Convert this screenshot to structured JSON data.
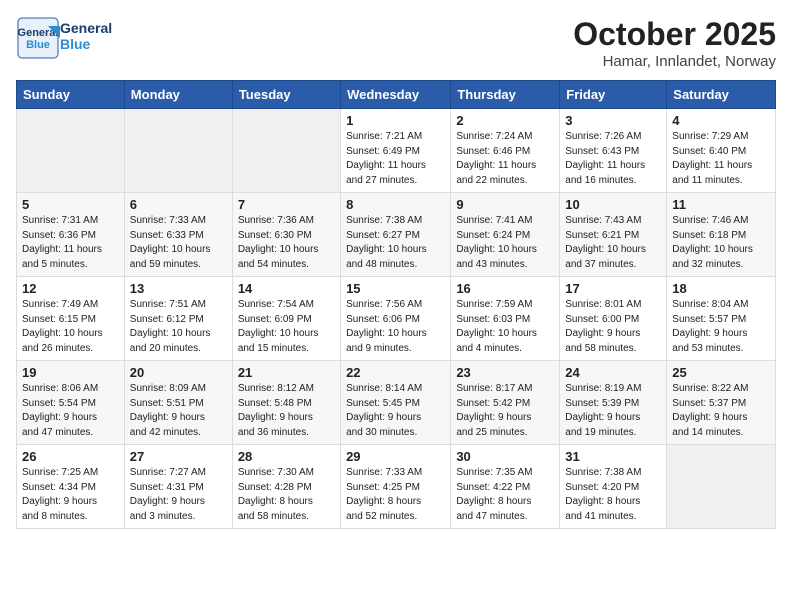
{
  "header": {
    "logo_text_top": "General",
    "logo_text_bottom": "Blue",
    "month_title": "October 2025",
    "location": "Hamar, Innlandet, Norway"
  },
  "days_of_week": [
    "Sunday",
    "Monday",
    "Tuesday",
    "Wednesday",
    "Thursday",
    "Friday",
    "Saturday"
  ],
  "weeks": [
    [
      {
        "day": "",
        "info": ""
      },
      {
        "day": "",
        "info": ""
      },
      {
        "day": "",
        "info": ""
      },
      {
        "day": "1",
        "info": "Sunrise: 7:21 AM\nSunset: 6:49 PM\nDaylight: 11 hours\nand 27 minutes."
      },
      {
        "day": "2",
        "info": "Sunrise: 7:24 AM\nSunset: 6:46 PM\nDaylight: 11 hours\nand 22 minutes."
      },
      {
        "day": "3",
        "info": "Sunrise: 7:26 AM\nSunset: 6:43 PM\nDaylight: 11 hours\nand 16 minutes."
      },
      {
        "day": "4",
        "info": "Sunrise: 7:29 AM\nSunset: 6:40 PM\nDaylight: 11 hours\nand 11 minutes."
      }
    ],
    [
      {
        "day": "5",
        "info": "Sunrise: 7:31 AM\nSunset: 6:36 PM\nDaylight: 11 hours\nand 5 minutes."
      },
      {
        "day": "6",
        "info": "Sunrise: 7:33 AM\nSunset: 6:33 PM\nDaylight: 10 hours\nand 59 minutes."
      },
      {
        "day": "7",
        "info": "Sunrise: 7:36 AM\nSunset: 6:30 PM\nDaylight: 10 hours\nand 54 minutes."
      },
      {
        "day": "8",
        "info": "Sunrise: 7:38 AM\nSunset: 6:27 PM\nDaylight: 10 hours\nand 48 minutes."
      },
      {
        "day": "9",
        "info": "Sunrise: 7:41 AM\nSunset: 6:24 PM\nDaylight: 10 hours\nand 43 minutes."
      },
      {
        "day": "10",
        "info": "Sunrise: 7:43 AM\nSunset: 6:21 PM\nDaylight: 10 hours\nand 37 minutes."
      },
      {
        "day": "11",
        "info": "Sunrise: 7:46 AM\nSunset: 6:18 PM\nDaylight: 10 hours\nand 32 minutes."
      }
    ],
    [
      {
        "day": "12",
        "info": "Sunrise: 7:49 AM\nSunset: 6:15 PM\nDaylight: 10 hours\nand 26 minutes."
      },
      {
        "day": "13",
        "info": "Sunrise: 7:51 AM\nSunset: 6:12 PM\nDaylight: 10 hours\nand 20 minutes."
      },
      {
        "day": "14",
        "info": "Sunrise: 7:54 AM\nSunset: 6:09 PM\nDaylight: 10 hours\nand 15 minutes."
      },
      {
        "day": "15",
        "info": "Sunrise: 7:56 AM\nSunset: 6:06 PM\nDaylight: 10 hours\nand 9 minutes."
      },
      {
        "day": "16",
        "info": "Sunrise: 7:59 AM\nSunset: 6:03 PM\nDaylight: 10 hours\nand 4 minutes."
      },
      {
        "day": "17",
        "info": "Sunrise: 8:01 AM\nSunset: 6:00 PM\nDaylight: 9 hours\nand 58 minutes."
      },
      {
        "day": "18",
        "info": "Sunrise: 8:04 AM\nSunset: 5:57 PM\nDaylight: 9 hours\nand 53 minutes."
      }
    ],
    [
      {
        "day": "19",
        "info": "Sunrise: 8:06 AM\nSunset: 5:54 PM\nDaylight: 9 hours\nand 47 minutes."
      },
      {
        "day": "20",
        "info": "Sunrise: 8:09 AM\nSunset: 5:51 PM\nDaylight: 9 hours\nand 42 minutes."
      },
      {
        "day": "21",
        "info": "Sunrise: 8:12 AM\nSunset: 5:48 PM\nDaylight: 9 hours\nand 36 minutes."
      },
      {
        "day": "22",
        "info": "Sunrise: 8:14 AM\nSunset: 5:45 PM\nDaylight: 9 hours\nand 30 minutes."
      },
      {
        "day": "23",
        "info": "Sunrise: 8:17 AM\nSunset: 5:42 PM\nDaylight: 9 hours\nand 25 minutes."
      },
      {
        "day": "24",
        "info": "Sunrise: 8:19 AM\nSunset: 5:39 PM\nDaylight: 9 hours\nand 19 minutes."
      },
      {
        "day": "25",
        "info": "Sunrise: 8:22 AM\nSunset: 5:37 PM\nDaylight: 9 hours\nand 14 minutes."
      }
    ],
    [
      {
        "day": "26",
        "info": "Sunrise: 7:25 AM\nSunset: 4:34 PM\nDaylight: 9 hours\nand 8 minutes."
      },
      {
        "day": "27",
        "info": "Sunrise: 7:27 AM\nSunset: 4:31 PM\nDaylight: 9 hours\nand 3 minutes."
      },
      {
        "day": "28",
        "info": "Sunrise: 7:30 AM\nSunset: 4:28 PM\nDaylight: 8 hours\nand 58 minutes."
      },
      {
        "day": "29",
        "info": "Sunrise: 7:33 AM\nSunset: 4:25 PM\nDaylight: 8 hours\nand 52 minutes."
      },
      {
        "day": "30",
        "info": "Sunrise: 7:35 AM\nSunset: 4:22 PM\nDaylight: 8 hours\nand 47 minutes."
      },
      {
        "day": "31",
        "info": "Sunrise: 7:38 AM\nSunset: 4:20 PM\nDaylight: 8 hours\nand 41 minutes."
      },
      {
        "day": "",
        "info": ""
      }
    ]
  ]
}
